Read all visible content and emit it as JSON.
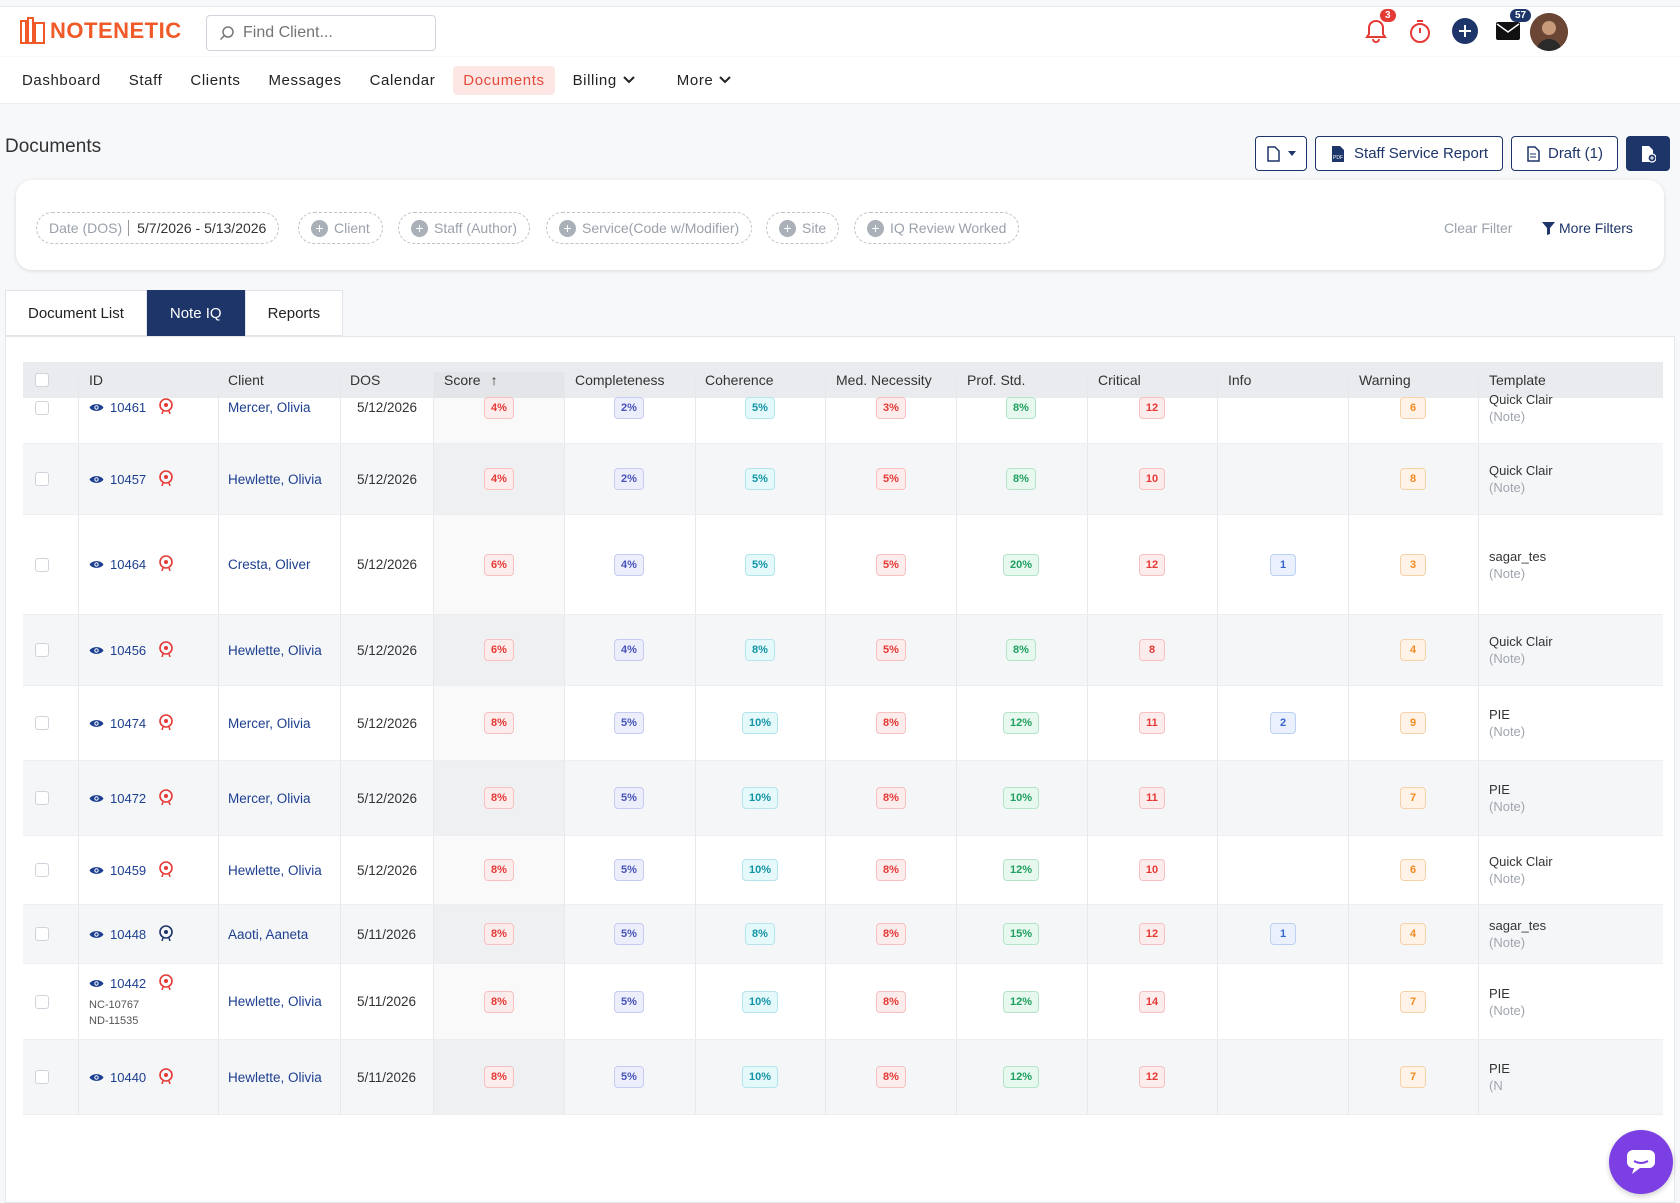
{
  "brand": {
    "name": "NOTENETIC",
    "color": "#f05a28"
  },
  "search": {
    "placeholder": "Find Client..."
  },
  "top_icons": {
    "notifications_count": "3",
    "messages_count": "57"
  },
  "nav": [
    {
      "label": "Dashboard"
    },
    {
      "label": "Staff"
    },
    {
      "label": "Clients"
    },
    {
      "label": "Messages"
    },
    {
      "label": "Calendar"
    },
    {
      "label": "Documents",
      "active": true
    },
    {
      "label": "Billing",
      "dropdown": true
    },
    {
      "label": "More",
      "dropdown": true
    }
  ],
  "page": {
    "title": "Documents"
  },
  "header_buttons": {
    "staff_service_report": "Staff Service Report",
    "draft": "Draft (1)"
  },
  "filters": {
    "date_label": "Date (DOS)",
    "date_value": "5/7/2026 - 5/13/2026",
    "client": "Client",
    "staff": "Staff (Author)",
    "service": "Service(Code w/Modifier)",
    "site": "Site",
    "iq_review": "IQ Review Worked",
    "clear": "Clear Filter",
    "more": "More Filters"
  },
  "tabs": [
    {
      "label": "Document List"
    },
    {
      "label": "Note IQ",
      "active": true
    },
    {
      "label": "Reports"
    }
  ],
  "table": {
    "columns": [
      "ID",
      "Client",
      "DOS",
      "Score",
      "Completeness",
      "Coherence",
      "Med. Necessity",
      "Prof. Std.",
      "Critical",
      "Info",
      "Warning",
      "Template"
    ],
    "sort_indicator": "↑",
    "rows": [
      {
        "id": "10461",
        "client": "Mercer, Olivia",
        "dos": "5/12/2026",
        "score": "4%",
        "completeness": "2%",
        "coherence": "5%",
        "med": "3%",
        "prof": "8%",
        "critical": "12",
        "info": "",
        "warning": "6",
        "template": "Quick Clair",
        "template_sub": "(Note)"
      },
      {
        "id": "10457",
        "client": "Hewlette, Olivia",
        "dos": "5/12/2026",
        "score": "4%",
        "completeness": "2%",
        "coherence": "5%",
        "med": "5%",
        "prof": "8%",
        "critical": "10",
        "info": "",
        "warning": "8",
        "template": "Quick Clair",
        "template_sub": "(Note)"
      },
      {
        "id": "10464",
        "client": "Cresta, Oliver",
        "dos": "5/12/2026",
        "score": "6%",
        "completeness": "4%",
        "coherence": "5%",
        "med": "5%",
        "prof": "20%",
        "critical": "12",
        "info": "1",
        "warning": "3",
        "template": "sagar_tes",
        "template_sub": "(Note)"
      },
      {
        "id": "10456",
        "client": "Hewlette, Olivia",
        "dos": "5/12/2026",
        "score": "6%",
        "completeness": "4%",
        "coherence": "8%",
        "med": "5%",
        "prof": "8%",
        "critical": "8",
        "info": "",
        "warning": "4",
        "template": "Quick Clair",
        "template_sub": "(Note)"
      },
      {
        "id": "10474",
        "client": "Mercer, Olivia",
        "dos": "5/12/2026",
        "score": "8%",
        "completeness": "5%",
        "coherence": "10%",
        "med": "8%",
        "prof": "12%",
        "critical": "11",
        "info": "2",
        "warning": "9",
        "template": "PIE",
        "template_sub": "(Note)"
      },
      {
        "id": "10472",
        "client": "Mercer, Olivia",
        "dos": "5/12/2026",
        "score": "8%",
        "completeness": "5%",
        "coherence": "10%",
        "med": "8%",
        "prof": "10%",
        "critical": "11",
        "info": "",
        "warning": "7",
        "template": "PIE",
        "template_sub": "(Note)"
      },
      {
        "id": "10459",
        "client": "Hewlette, Olivia",
        "dos": "5/12/2026",
        "score": "8%",
        "completeness": "5%",
        "coherence": "10%",
        "med": "8%",
        "prof": "12%",
        "critical": "10",
        "info": "",
        "warning": "6",
        "template": "Quick Clair",
        "template_sub": "(Note)"
      },
      {
        "id": "10448",
        "client": "Aaoti, Aaneta",
        "dos": "5/11/2026",
        "score": "8%",
        "completeness": "5%",
        "coherence": "8%",
        "med": "8%",
        "prof": "15%",
        "critical": "12",
        "info": "1",
        "warning": "4",
        "template": "sagar_tes",
        "template_sub": "(Note)"
      },
      {
        "id": "10442",
        "sub1": "NC-10767",
        "sub2": "ND-11535",
        "client": "Hewlette, Olivia",
        "dos": "5/11/2026",
        "score": "8%",
        "completeness": "5%",
        "coherence": "10%",
        "med": "8%",
        "prof": "12%",
        "critical": "14",
        "info": "",
        "warning": "7",
        "template": "PIE",
        "template_sub": "(Note)"
      },
      {
        "id": "10440",
        "client": "Hewlette, Olivia",
        "dos": "5/11/2026",
        "score": "8%",
        "completeness": "5%",
        "coherence": "10%",
        "med": "8%",
        "prof": "12%",
        "critical": "12",
        "info": "",
        "warning": "7",
        "template": "PIE",
        "template_sub": "(N"
      }
    ]
  }
}
